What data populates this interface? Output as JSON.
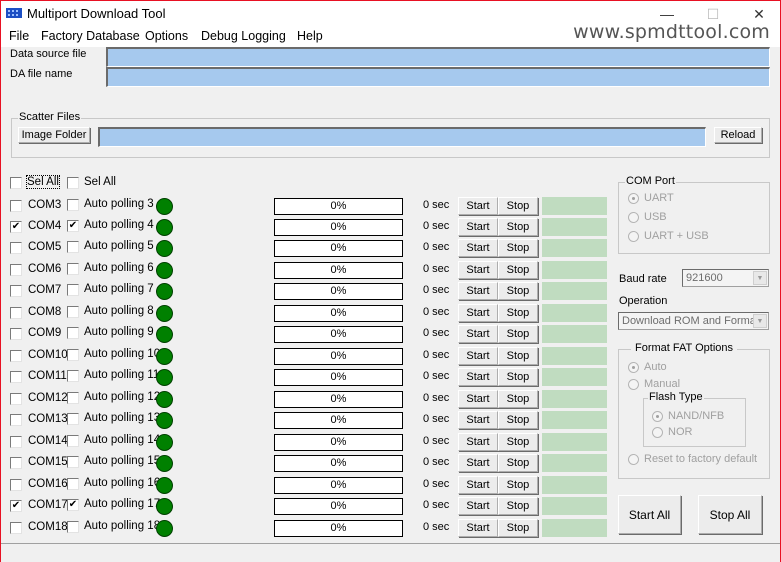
{
  "window": {
    "title": "Multiport Download Tool",
    "brand_text": "www.spmdttool.com",
    "controls": {
      "minimize": "—",
      "maximize": "☐",
      "close": "✕"
    }
  },
  "menu": [
    "File",
    "Factory Database",
    "Options",
    "Debug Logging",
    "Help"
  ],
  "files": {
    "data_source_label": "Data source file",
    "data_source_value": "",
    "da_file_label": "DA file name",
    "da_file_value": ""
  },
  "scatter": {
    "group_title": "Scatter Files",
    "image_folder_label": "Image Folder",
    "path_value": "",
    "reload_label": "Reload"
  },
  "select_all": {
    "com_label": "Sel All",
    "com_checked": false,
    "poll_label": "Sel All",
    "poll_checked": false
  },
  "ports": [
    {
      "com": "COM3",
      "com_checked": false,
      "poll": "Auto polling 3",
      "poll_checked": false,
      "progress": "0%",
      "time": "0 sec",
      "start": "Start",
      "stop": "Stop"
    },
    {
      "com": "COM4",
      "com_checked": true,
      "poll": "Auto polling 4",
      "poll_checked": true,
      "progress": "0%",
      "time": "0 sec",
      "start": "Start",
      "stop": "Stop"
    },
    {
      "com": "COM5",
      "com_checked": false,
      "poll": "Auto polling 5",
      "poll_checked": false,
      "progress": "0%",
      "time": "0 sec",
      "start": "Start",
      "stop": "Stop"
    },
    {
      "com": "COM6",
      "com_checked": false,
      "poll": "Auto polling 6",
      "poll_checked": false,
      "progress": "0%",
      "time": "0 sec",
      "start": "Start",
      "stop": "Stop"
    },
    {
      "com": "COM7",
      "com_checked": false,
      "poll": "Auto polling 7",
      "poll_checked": false,
      "progress": "0%",
      "time": "0 sec",
      "start": "Start",
      "stop": "Stop"
    },
    {
      "com": "COM8",
      "com_checked": false,
      "poll": "Auto polling 8",
      "poll_checked": false,
      "progress": "0%",
      "time": "0 sec",
      "start": "Start",
      "stop": "Stop"
    },
    {
      "com": "COM9",
      "com_checked": false,
      "poll": "Auto polling 9",
      "poll_checked": false,
      "progress": "0%",
      "time": "0 sec",
      "start": "Start",
      "stop": "Stop"
    },
    {
      "com": "COM10",
      "com_checked": false,
      "poll": "Auto polling 10",
      "poll_checked": false,
      "progress": "0%",
      "time": "0 sec",
      "start": "Start",
      "stop": "Stop"
    },
    {
      "com": "COM11",
      "com_checked": false,
      "poll": "Auto polling 11",
      "poll_checked": false,
      "progress": "0%",
      "time": "0 sec",
      "start": "Start",
      "stop": "Stop"
    },
    {
      "com": "COM12",
      "com_checked": false,
      "poll": "Auto polling 12",
      "poll_checked": false,
      "progress": "0%",
      "time": "0 sec",
      "start": "Start",
      "stop": "Stop"
    },
    {
      "com": "COM13",
      "com_checked": false,
      "poll": "Auto polling 13",
      "poll_checked": false,
      "progress": "0%",
      "time": "0 sec",
      "start": "Start",
      "stop": "Stop"
    },
    {
      "com": "COM14",
      "com_checked": false,
      "poll": "Auto polling 14",
      "poll_checked": false,
      "progress": "0%",
      "time": "0 sec",
      "start": "Start",
      "stop": "Stop"
    },
    {
      "com": "COM15",
      "com_checked": false,
      "poll": "Auto polling 15",
      "poll_checked": false,
      "progress": "0%",
      "time": "0 sec",
      "start": "Start",
      "stop": "Stop"
    },
    {
      "com": "COM16",
      "com_checked": false,
      "poll": "Auto polling 16",
      "poll_checked": false,
      "progress": "0%",
      "time": "0 sec",
      "start": "Start",
      "stop": "Stop"
    },
    {
      "com": "COM17",
      "com_checked": true,
      "poll": "Auto polling 17",
      "poll_checked": true,
      "progress": "0%",
      "time": "0 sec",
      "start": "Start",
      "stop": "Stop"
    },
    {
      "com": "COM18",
      "com_checked": false,
      "poll": "Auto polling 18",
      "poll_checked": false,
      "progress": "0%",
      "time": "0 sec",
      "start": "Start",
      "stop": "Stop"
    }
  ],
  "colors": {
    "led_green": "#008000",
    "status_cell": "#c0dcc0",
    "field_blue": "#a6c9ee"
  },
  "com_port": {
    "title": "COM Port",
    "options": [
      {
        "label": "UART",
        "selected": true
      },
      {
        "label": "USB",
        "selected": false
      },
      {
        "label": "UART + USB",
        "selected": false
      }
    ]
  },
  "baud": {
    "label": "Baud rate",
    "value": "921600"
  },
  "operation": {
    "label": "Operation",
    "value": "Download ROM and Forma"
  },
  "format_fat": {
    "title": "Format FAT Options",
    "auto": {
      "label": "Auto",
      "selected": true
    },
    "manual": {
      "label": "Manual",
      "selected": false
    },
    "flash_type": {
      "title": "Flash  Type",
      "nand": {
        "label": "NAND/NFB",
        "selected": true
      },
      "nor": {
        "label": "NOR",
        "selected": false
      }
    },
    "reset": {
      "label": "Reset to factory default",
      "selected": false
    }
  },
  "actions": {
    "start_all": "Start All",
    "stop_all": "Stop All"
  }
}
